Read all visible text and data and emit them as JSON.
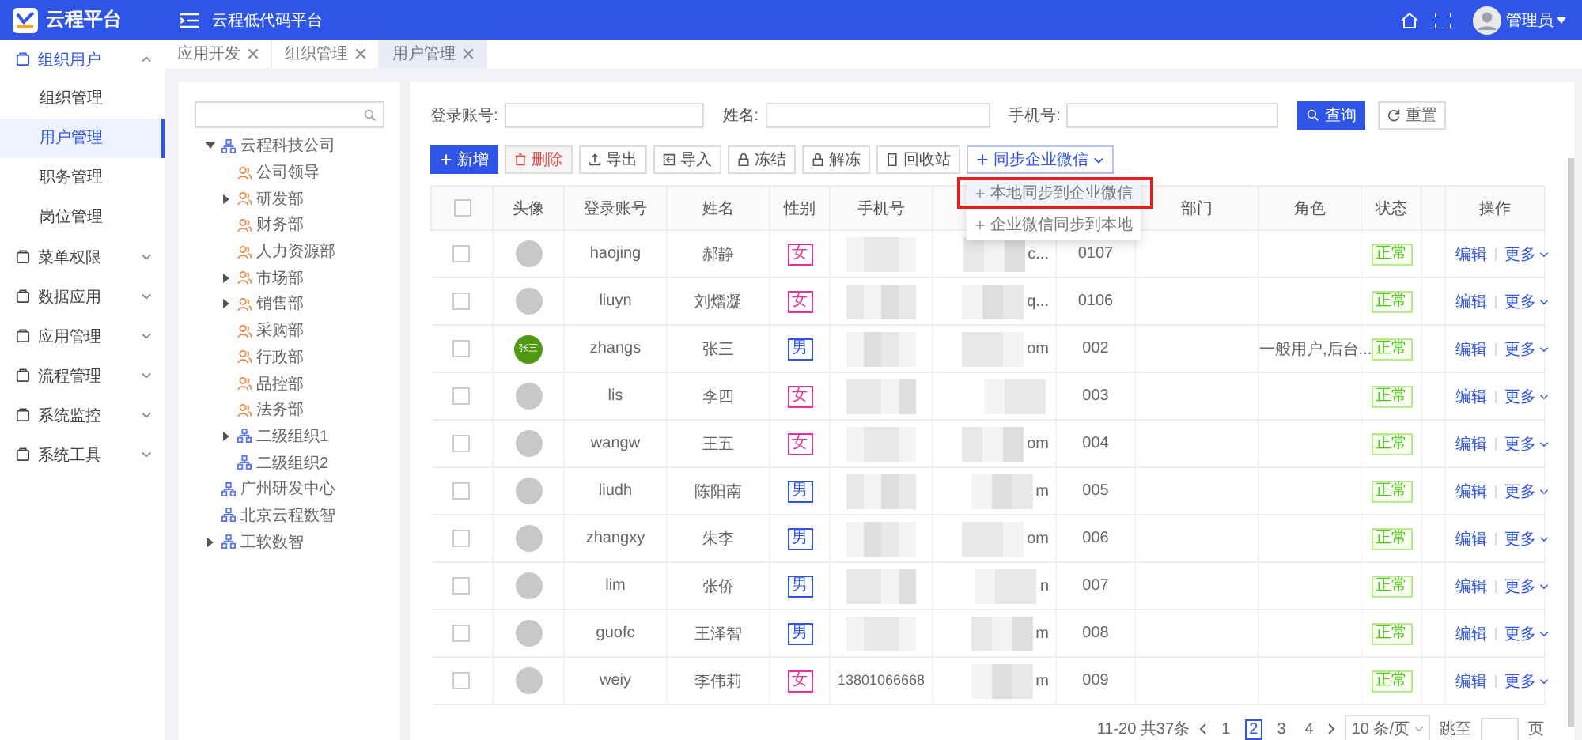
{
  "header": {
    "logo_text": "云程平台",
    "title": "云程低代码平台",
    "user": "管理员"
  },
  "sidebar": {
    "items": [
      {
        "label": "组织用户",
        "expanded": true,
        "children": [
          {
            "label": "组织管理",
            "selected": false
          },
          {
            "label": "用户管理",
            "selected": true
          },
          {
            "label": "职务管理",
            "selected": false
          },
          {
            "label": "岗位管理",
            "selected": false
          }
        ]
      },
      {
        "label": "菜单权限",
        "expanded": false
      },
      {
        "label": "数据应用",
        "expanded": false
      },
      {
        "label": "应用管理",
        "expanded": false
      },
      {
        "label": "流程管理",
        "expanded": false
      },
      {
        "label": "系统监控",
        "expanded": false
      },
      {
        "label": "系统工具",
        "expanded": false
      }
    ]
  },
  "tabs": [
    {
      "label": "应用开发",
      "selected": false
    },
    {
      "label": "组织管理",
      "selected": false
    },
    {
      "label": "用户管理",
      "selected": true
    }
  ],
  "tree": {
    "nodes": [
      {
        "label": "云程科技公司",
        "kind": "org",
        "expanded": true,
        "children": [
          {
            "label": "公司领导",
            "kind": "dept"
          },
          {
            "label": "研发部",
            "kind": "dept",
            "expanded": false
          },
          {
            "label": "财务部",
            "kind": "dept"
          },
          {
            "label": "人力资源部",
            "kind": "dept"
          },
          {
            "label": "市场部",
            "kind": "dept",
            "expanded": false
          },
          {
            "label": "销售部",
            "kind": "dept",
            "expanded": false
          },
          {
            "label": "采购部",
            "kind": "dept"
          },
          {
            "label": "行政部",
            "kind": "dept"
          },
          {
            "label": "品控部",
            "kind": "dept"
          },
          {
            "label": "法务部",
            "kind": "dept"
          },
          {
            "label": "二级组织1",
            "kind": "org",
            "expanded": false
          },
          {
            "label": "二级组织2",
            "kind": "org"
          }
        ]
      },
      {
        "label": "广州研发中心",
        "kind": "org"
      },
      {
        "label": "北京云程数智",
        "kind": "org"
      },
      {
        "label": "工软数智",
        "kind": "org",
        "expanded": false
      }
    ]
  },
  "search": {
    "fields": [
      {
        "label": "登录账号:"
      },
      {
        "label": "姓名:"
      },
      {
        "label": "手机号:"
      }
    ],
    "query_button": "查询",
    "reset_button": "重置"
  },
  "toolbar": [
    {
      "label": "新增",
      "kind": "primary"
    },
    {
      "label": "删除",
      "kind": "danger"
    },
    {
      "label": "导出",
      "kind": "export"
    },
    {
      "label": "导入",
      "kind": "import"
    },
    {
      "label": "冻结",
      "kind": "lock"
    },
    {
      "label": "解冻",
      "kind": "unlock"
    },
    {
      "label": "回收站",
      "kind": "bin"
    },
    {
      "label": "同步企业微信",
      "kind": "sync"
    }
  ],
  "sync_menu": [
    {
      "label": "本地同步到企业微信",
      "selected": true
    },
    {
      "label": "企业微信同步到本地",
      "selected": false
    }
  ],
  "table": {
    "header_checked": false,
    "columns": [
      {
        "kind": "check"
      },
      {
        "kind": "text",
        "label": "头像"
      },
      {
        "kind": "text",
        "label": "登录账号"
      },
      {
        "kind": "text",
        "label": "姓名"
      },
      {
        "kind": "text",
        "label": "性别"
      },
      {
        "kind": "text",
        "label": "手机号"
      },
      {
        "kind": "blank"
      },
      {
        "kind": "blank"
      },
      {
        "kind": "text",
        "label": "部门"
      },
      {
        "kind": "text",
        "label": "角色"
      },
      {
        "kind": "text",
        "label": "状态"
      },
      {
        "kind": "blank"
      },
      {
        "kind": "text",
        "label": "操作"
      }
    ],
    "rows": [
      {
        "checked": false,
        "avatar": {
          "kind": "blank"
        },
        "account": "haojing",
        "name": "郝静",
        "gender": {
          "text": "女",
          "color": "#eb2f96"
        },
        "column_7": "c...",
        "column_8": "0107",
        "status": "正常",
        "actions": [
          "编辑",
          "更多"
        ]
      },
      {
        "checked": false,
        "avatar": {
          "kind": "blank"
        },
        "account": "liuyn",
        "name": "刘熠凝",
        "gender": {
          "text": "女",
          "color": "#eb2f96"
        },
        "column_7": "q...",
        "column_8": "0106",
        "status": "正常",
        "actions": [
          "编辑",
          "更多"
        ]
      },
      {
        "checked": false,
        "avatar": {
          "kind": "initials",
          "text": "张三"
        },
        "account": "zhangs",
        "name": "张三",
        "gender": {
          "text": "男",
          "color": "#2f55e8"
        },
        "column_7": "om",
        "column_8": "002",
        "role": "一般用户,后台...",
        "status": "正常",
        "actions": [
          "编辑",
          "更多"
        ]
      },
      {
        "checked": false,
        "avatar": {
          "kind": "blank"
        },
        "account": "lis",
        "name": "李四",
        "gender": {
          "text": "女",
          "color": "#eb2f96"
        },
        "column_8": "003",
        "status": "正常",
        "actions": [
          "编辑",
          "更多"
        ]
      },
      {
        "checked": false,
        "avatar": {
          "kind": "blank"
        },
        "account": "wangw",
        "name": "王五",
        "gender": {
          "text": "女",
          "color": "#eb2f96"
        },
        "column_7": "om",
        "column_8": "004",
        "status": "正常",
        "actions": [
          "编辑",
          "更多"
        ]
      },
      {
        "checked": false,
        "avatar": {
          "kind": "blank"
        },
        "account": "liudh",
        "name": "陈阳南",
        "gender": {
          "text": "男",
          "color": "#2f55e8"
        },
        "column_7": "m",
        "column_8": "005",
        "status": "正常",
        "actions": [
          "编辑",
          "更多"
        ]
      },
      {
        "checked": false,
        "avatar": {
          "kind": "blank"
        },
        "account": "zhangxy",
        "name": "朱李",
        "gender": {
          "text": "男",
          "color": "#2f55e8"
        },
        "column_7": "om",
        "column_8": "006",
        "status": "正常",
        "actions": [
          "编辑",
          "更多"
        ]
      },
      {
        "checked": false,
        "avatar": {
          "kind": "blank"
        },
        "account": "lim",
        "name": "张侨",
        "gender": {
          "text": "男",
          "color": "#2f55e8"
        },
        "column_7": "n",
        "column_8": "007",
        "status": "正常",
        "actions": [
          "编辑",
          "更多"
        ]
      },
      {
        "checked": false,
        "avatar": {
          "kind": "blank"
        },
        "account": "guofc",
        "name": "王泽智",
        "gender": {
          "text": "男",
          "color": "#2f55e8"
        },
        "column_7": "m",
        "column_8": "008",
        "status": "正常",
        "actions": [
          "编辑",
          "更多"
        ]
      },
      {
        "checked": false,
        "avatar": {
          "kind": "blank"
        },
        "account": "weiy",
        "name": "李伟莉",
        "gender": {
          "text": "女",
          "color": "#eb2f96"
        },
        "phone": "13801066668",
        "column_7": "m",
        "column_8": "009",
        "status": "正常",
        "actions": [
          "编辑",
          "更多"
        ]
      }
    ]
  },
  "pagination": {
    "summary": "11-20 共37条",
    "pages": [
      {
        "label": "1",
        "selected": false
      },
      {
        "label": "2",
        "selected": true
      },
      {
        "label": "3",
        "selected": false
      },
      {
        "label": "4",
        "selected": false
      }
    ],
    "page_size": "10 条/页",
    "jump_label": "跳至",
    "page_suffix": "页"
  }
}
